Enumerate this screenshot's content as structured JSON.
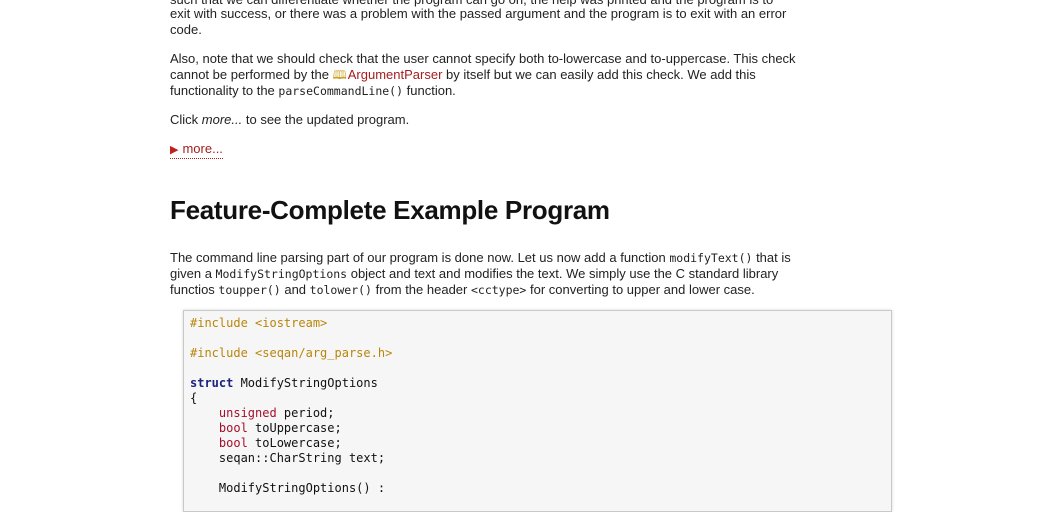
{
  "doc": {
    "cutoff_line": "such that we can differentiate whether the program can go on, the help was printed and the program is to",
    "p1": {
      "text_a": "exit with success, or there was a problem with the passed argument and the program is to exit with an error",
      "text_b": "code."
    },
    "p2": {
      "text_a": "Also, note that we should check that the user cannot specify both to-lowercase and to-uppercase. This check",
      "text_b_before": "cannot be performed by the ",
      "link_label": "ArgumentParser",
      "text_b_after": " by itself but we can easily add this check. We add this",
      "text_c_before": "functionality to the ",
      "code_fn": "parseCommandLine()",
      "text_c_after": " function."
    },
    "p3": {
      "before": "Click ",
      "em": "more...",
      "after": " to see the updated program."
    },
    "more_label": "more...",
    "section_title": "Feature-Complete Example Program",
    "p4": {
      "l1_before": "The command line parsing part of our program is done now. Let us now add a function ",
      "l1_code": "modifyText()",
      "l1_after": " that is",
      "l2_before": "given a ",
      "l2_code": "ModifyStringOptions",
      "l2_after": " object and text and modifies the text. We simply use the C standard library",
      "l3_before": "functios ",
      "l3_code1": "toupper()",
      "l3_mid1": " and ",
      "l3_code2": "tolower()",
      "l3_mid2": " from the header ",
      "l3_code3": "<cctype>",
      "l3_after": " for converting to upper and lower case."
    },
    "code": {
      "line1": "#include <iostream>",
      "line3": "#include <seqan/arg_parse.h>",
      "line5_kw": "struct",
      "line5_name": " ModifyStringOptions",
      "line6": "{",
      "line7_ty": "unsigned",
      "line7_rest": " period;",
      "line8_ty": "bool",
      "line8_rest": " toUppercase;",
      "line9_ty": "bool",
      "line9_rest": " toLowercase;",
      "line10": "seqan::CharString text;",
      "line12": "ModifyStringOptions() :"
    }
  }
}
